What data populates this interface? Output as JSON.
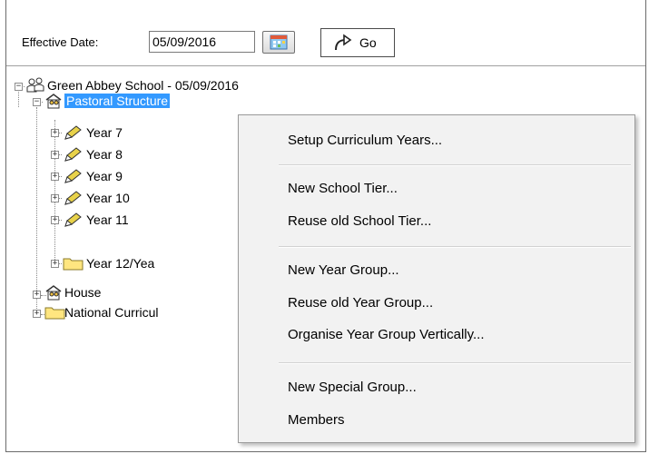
{
  "toolbar": {
    "effective_date_label": "Effective Date:",
    "effective_date_value": "05/09/2016",
    "calendar_icon": "calendar-icon",
    "go_icon": "redo-arrow-icon",
    "go_label": "Go"
  },
  "tree": {
    "root": {
      "label": "Green Abbey School - 05/09/2016",
      "icon": "school-people-icon"
    },
    "pastoral": {
      "label": "Pastoral Structure",
      "icon": "house-people-icon"
    },
    "years": [
      {
        "label": "Year  7",
        "icon": "pencil-icon"
      },
      {
        "label": "Year  8",
        "icon": "pencil-icon"
      },
      {
        "label": "Year  9",
        "icon": "pencil-icon"
      },
      {
        "label": "Year 10",
        "icon": "pencil-icon"
      },
      {
        "label": "Year 11",
        "icon": "pencil-icon"
      },
      {
        "label": "Year 12/Yea",
        "icon": "folder-icon"
      }
    ],
    "house": {
      "label": "House",
      "icon": "house-people-icon"
    },
    "national": {
      "label": "National Curricul",
      "icon": "folder-icon"
    }
  },
  "context_menu": {
    "items": [
      "Setup Curriculum Years...",
      "New School Tier...",
      "Reuse old School Tier...",
      "New Year Group...",
      "Reuse old Year Group...",
      "Organise Year Group Vertically...",
      "New Special Group...",
      "Members"
    ]
  },
  "colors": {
    "selection": "#3399ff",
    "menu_background": "#f2f2f2",
    "folder": "#ffe680",
    "pencil": "#e8d24a"
  }
}
